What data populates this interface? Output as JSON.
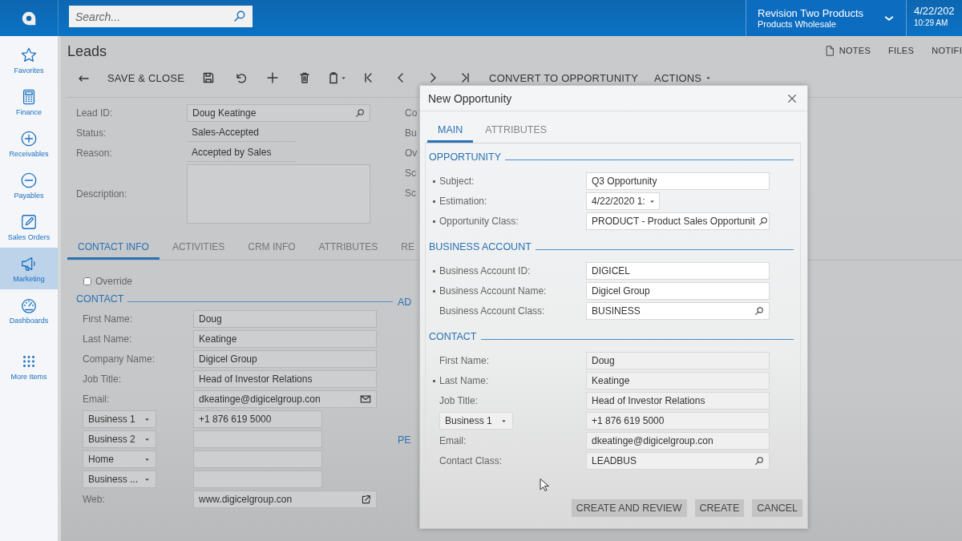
{
  "header": {
    "search_placeholder": "Search...",
    "company": "Revision Two Products",
    "branch": "Products Wholesale",
    "date": "4/22/202",
    "time": "10:29 AM"
  },
  "sidebar": [
    {
      "label": "Favorites",
      "selected": false
    },
    {
      "label": "Finance",
      "selected": false
    },
    {
      "label": "Receivables",
      "selected": false
    },
    {
      "label": "Payables",
      "selected": false
    },
    {
      "label": "Sales Orders",
      "selected": false
    },
    {
      "label": "Marketing",
      "selected": true
    },
    {
      "label": "Dashboards",
      "selected": false
    },
    {
      "label": "More Items",
      "selected": false
    }
  ],
  "page": {
    "title": "Leads",
    "top_links": [
      "NOTES",
      "FILES",
      "NOTIFI"
    ],
    "toolbar": {
      "save_close": "SAVE & CLOSE",
      "convert": "CONVERT TO OPPORTUNITY",
      "actions": "ACTIONS"
    },
    "summary": [
      {
        "label": "Lead ID:",
        "value": "Doug Keatinge",
        "kind": "lookup"
      },
      {
        "label": "Status:",
        "value": "Sales-Accepted",
        "kind": "plain"
      },
      {
        "label": "Reason:",
        "value": "Accepted by Sales",
        "kind": "plain"
      },
      {
        "label": "Description:",
        "kind": "textarea"
      }
    ],
    "right_labels": [
      "Co",
      "Bu",
      "Ov",
      "Sc",
      "Sc"
    ],
    "tabs": [
      {
        "label": "CONTACT INFO",
        "selected": true
      },
      {
        "label": "ACTIVITIES",
        "selected": false
      },
      {
        "label": "CRM INFO",
        "selected": false
      },
      {
        "label": "ATTRIBUTES",
        "selected": false
      },
      {
        "label": "RE",
        "selected": false
      }
    ],
    "override": {
      "label": "Override",
      "checked": false
    },
    "contact": {
      "title": "CONTACT",
      "fields": [
        {
          "kind": "text",
          "label": "First Name:",
          "value": "Doug"
        },
        {
          "kind": "text",
          "label": "Last Name:",
          "value": "Keatinge"
        },
        {
          "kind": "text",
          "label": "Company Name:",
          "value": "Digicel Group"
        },
        {
          "kind": "text",
          "label": "Job Title:",
          "value": "Head of Investor Relations"
        },
        {
          "kind": "email",
          "label": "Email:",
          "value": "dkeatinge@digicelgroup.con"
        },
        {
          "kind": "phone",
          "type": "Business 1",
          "value": "+1 876 619 5000"
        },
        {
          "kind": "phone",
          "type": "Business 2"
        },
        {
          "kind": "phone",
          "type": "Home"
        },
        {
          "kind": "phone",
          "type": "Business ..."
        },
        {
          "kind": "web",
          "label": "Web:",
          "value": "www.digicelgroup.con"
        }
      ]
    },
    "right_headings": [
      "AD",
      "PE"
    ]
  },
  "dialog": {
    "title": "New Opportunity",
    "tabs": [
      {
        "label": "MAIN",
        "selected": true
      },
      {
        "label": "ATTRIBUTES",
        "selected": false
      }
    ],
    "sections": [
      {
        "title": "OPPORTUNITY",
        "fields": [
          {
            "kind": "text",
            "label": "Subject:",
            "required": true,
            "value": "Q3 Opportunity"
          },
          {
            "kind": "date",
            "label": "Estimation:",
            "required": true,
            "value": "4/22/2020 1:"
          },
          {
            "kind": "lookup",
            "label": "Opportunity Class:",
            "required": true,
            "value": "PRODUCT - Product Sales Opportunit"
          }
        ]
      },
      {
        "title": "BUSINESS ACCOUNT",
        "fields": [
          {
            "kind": "text",
            "label": "Business Account ID:",
            "required": true,
            "value": "DIGICEL"
          },
          {
            "kind": "text",
            "label": "Business Account Name:",
            "required": true,
            "value": "Digicel Group"
          },
          {
            "kind": "lookup",
            "label": "Business Account Class:",
            "required": false,
            "value": "BUSINESS"
          }
        ]
      },
      {
        "title": "CONTACT",
        "fields": [
          {
            "kind": "text",
            "label": "First Name:",
            "required": false,
            "value": "Doug"
          },
          {
            "kind": "text",
            "label": "Last Name:",
            "required": true,
            "value": "Keatinge"
          },
          {
            "kind": "text",
            "label": "Job Title:",
            "required": false,
            "value": "Head of Investor Relations"
          },
          {
            "kind": "phone",
            "type": "Business 1",
            "required": false,
            "value": "+1 876 619 5000"
          },
          {
            "kind": "text",
            "label": "Email:",
            "required": false,
            "value": "dkeatinge@digicelgroup.con"
          },
          {
            "kind": "lookup",
            "label": "Contact Class:",
            "required": false,
            "value": "LEADBUS"
          }
        ]
      }
    ],
    "buttons": [
      "CREATE AND REVIEW",
      "CREATE",
      "CANCEL"
    ]
  }
}
